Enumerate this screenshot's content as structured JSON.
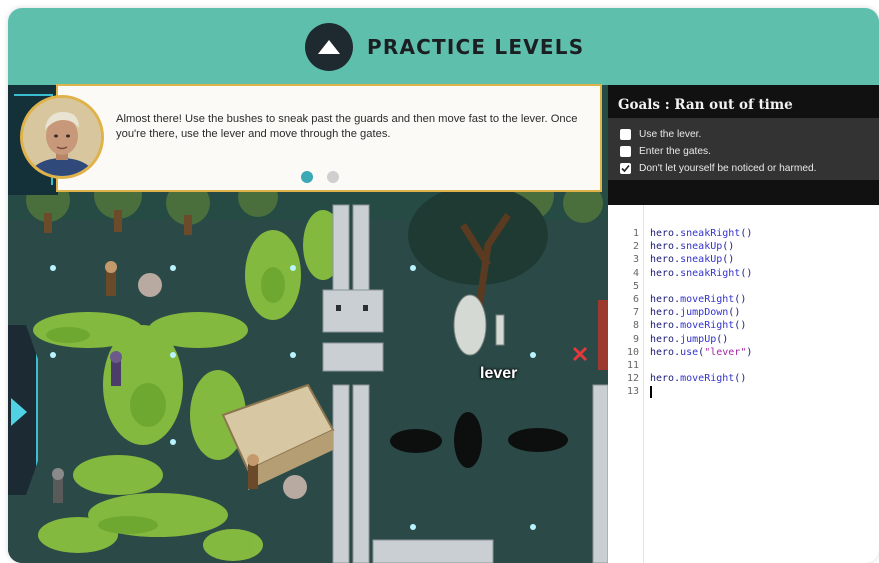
{
  "header": {
    "title": "PRACTICE LEVELS",
    "toggle_icon": "triangle-up-icon",
    "color": "#5fbfad"
  },
  "dialog": {
    "text": "Almost there! Use the bushes to sneak past the guards and then move fast to the lever. Once you're there, use the lever and move through the gates.",
    "page_count": 2,
    "active_page": 1
  },
  "game": {
    "object_label": "lever"
  },
  "goals": {
    "title": "Goals : Ran out of time",
    "items": [
      {
        "text": "Use the lever.",
        "checked": false
      },
      {
        "text": "Enter the gates.",
        "checked": false
      },
      {
        "text": "Don't let yourself be noticed or harmed.",
        "checked": true
      }
    ]
  },
  "editor": {
    "lines": [
      {
        "num": "1",
        "obj": "hero",
        "method": "sneakRight",
        "arg": ""
      },
      {
        "num": "2",
        "obj": "hero",
        "method": "sneakUp",
        "arg": ""
      },
      {
        "num": "3",
        "obj": "hero",
        "method": "sneakUp",
        "arg": ""
      },
      {
        "num": "4",
        "obj": "hero",
        "method": "sneakRight",
        "arg": ""
      },
      {
        "num": "5",
        "obj": "",
        "method": "",
        "arg": ""
      },
      {
        "num": "6",
        "obj": "hero",
        "method": "moveRight",
        "arg": ""
      },
      {
        "num": "7",
        "obj": "hero",
        "method": "jumpDown",
        "arg": ""
      },
      {
        "num": "8",
        "obj": "hero",
        "method": "moveRight",
        "arg": ""
      },
      {
        "num": "9",
        "obj": "hero",
        "method": "jumpUp",
        "arg": ""
      },
      {
        "num": "10",
        "obj": "hero",
        "method": "use",
        "arg": "\"lever\""
      },
      {
        "num": "11",
        "obj": "",
        "method": "",
        "arg": ""
      },
      {
        "num": "12",
        "obj": "hero",
        "method": "moveRight",
        "arg": ""
      },
      {
        "num": "13",
        "obj": "",
        "method": "",
        "arg": ""
      }
    ],
    "cursor_line": "13"
  }
}
